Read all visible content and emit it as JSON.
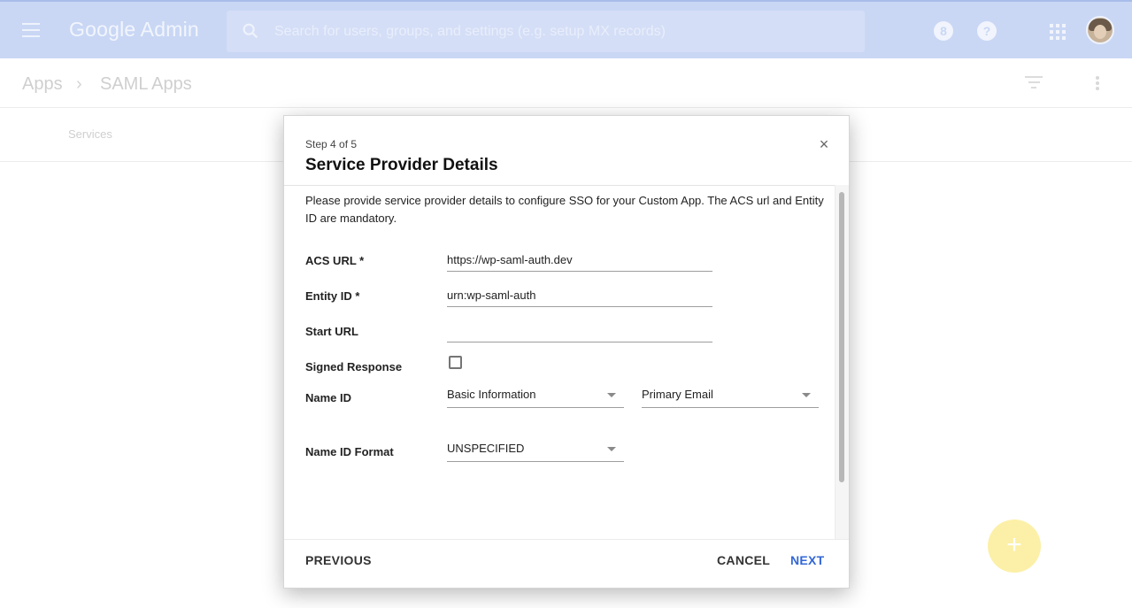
{
  "header": {
    "menu_icon": "menu-icon",
    "logo_text": "Google Admin",
    "search_placeholder": "Search for users, groups, and settings (e.g. setup MX records)",
    "notifications_badge": "8",
    "help_label": "?",
    "apps_icon": "apps-grid-icon",
    "avatar_icon": "avatar"
  },
  "breadcrumb": {
    "root": "Apps",
    "separator": "›",
    "current": "SAML Apps"
  },
  "toolbar": {
    "filter_icon": "filter-icon",
    "more_icon": "more-vert-icon"
  },
  "tabs": {
    "services_label": "Services"
  },
  "fab": {
    "label": "+"
  },
  "dialog": {
    "step": "Step 4 of 5",
    "title": "Service Provider Details",
    "close_label": "×",
    "description": "Please provide service provider details to configure SSO for your Custom App. The ACS url and Entity ID are mandatory.",
    "fields": {
      "acs_url_label": "ACS URL *",
      "acs_url_value": "https://wp-saml-auth.dev",
      "entity_id_label": "Entity ID *",
      "entity_id_value": "urn:wp-saml-auth",
      "start_url_label": "Start URL",
      "start_url_value": "",
      "signed_response_label": "Signed Response",
      "signed_response_checked": false,
      "name_id_label": "Name ID",
      "name_id_category": "Basic Information",
      "name_id_attribute": "Primary Email",
      "name_id_format_label": "Name ID Format",
      "name_id_format_value": "UNSPECIFIED"
    },
    "buttons": {
      "previous": "PREVIOUS",
      "cancel": "CANCEL",
      "next": "NEXT"
    }
  },
  "colors": {
    "header_bg": "#c9d7f5",
    "primary_button": "#3367d6",
    "fab": "#fcf0a8"
  }
}
